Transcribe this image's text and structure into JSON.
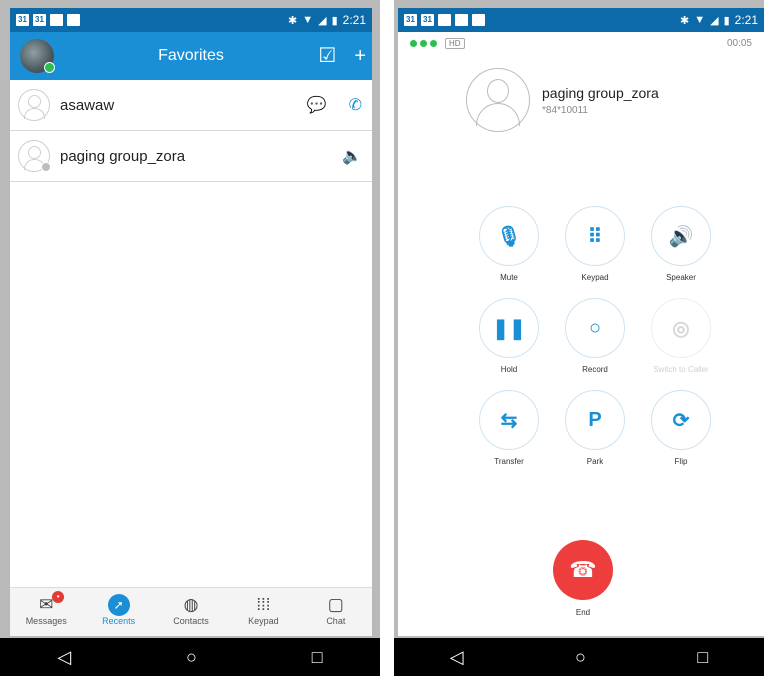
{
  "left": {
    "status": {
      "time": "2:21",
      "icons": [
        "31",
        "31",
        "▪",
        "◣"
      ]
    },
    "appbar": {
      "title": "Favorites",
      "edit_icon": "edit-checkbox-icon",
      "add_icon": "plus-icon"
    },
    "favorites": [
      {
        "name": "asawaw",
        "actions": [
          "chat-icon",
          "phone-icon"
        ]
      },
      {
        "name": "paging group_zora",
        "actions": [
          "speaker-icon"
        ]
      }
    ],
    "nav": [
      {
        "label": "Messages",
        "badge": "•"
      },
      {
        "label": "Recents"
      },
      {
        "label": "Contacts"
      },
      {
        "label": "Keypad"
      },
      {
        "label": "Chat"
      }
    ]
  },
  "right": {
    "status": {
      "time": "2:21"
    },
    "call": {
      "hd": "HD",
      "timer": "00:05",
      "name": "paging group_zora",
      "number": "*84*10011"
    },
    "buttons": [
      {
        "label": "Mute",
        "glyph": "🎙",
        "disabled": false
      },
      {
        "label": "Keypad",
        "glyph": "⠿",
        "disabled": false
      },
      {
        "label": "Speaker",
        "glyph": "🔊",
        "disabled": false
      },
      {
        "label": "Hold",
        "glyph": "❚❚",
        "disabled": false
      },
      {
        "label": "Record",
        "glyph": "○",
        "disabled": false
      },
      {
        "label": "Switch to Caller",
        "glyph": "◎",
        "disabled": true
      },
      {
        "label": "Transfer",
        "glyph": "⇆",
        "disabled": false
      },
      {
        "label": "Park",
        "glyph": "P",
        "disabled": false
      },
      {
        "label": "Flip",
        "glyph": "⟳",
        "disabled": false
      }
    ],
    "end_label": "End"
  },
  "sysnav": {
    "back": "◁",
    "home": "○",
    "recents": "□"
  },
  "colors": {
    "brand": "#1a8fd6",
    "statusbar": "#0d6aa8",
    "end": "#ee3d3d",
    "online": "#2ebd4f"
  }
}
